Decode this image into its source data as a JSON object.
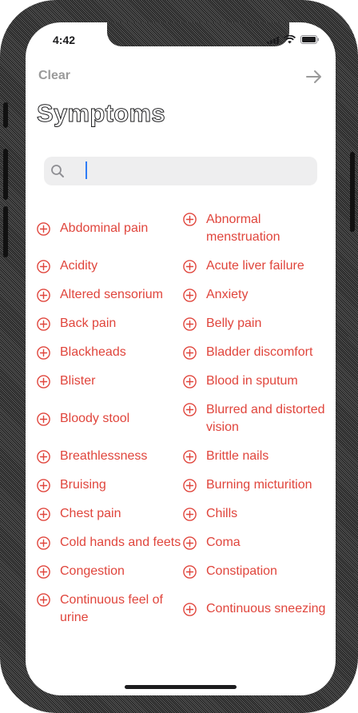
{
  "status_bar": {
    "time": "4:42"
  },
  "nav": {
    "clear_label": "Clear",
    "next_icon": "arrow-right-icon"
  },
  "title": "Symptoms",
  "search": {
    "value": "",
    "placeholder": ""
  },
  "colors": {
    "accent": "#e0453c",
    "muted": "#9a9a9a",
    "search_bg": "#eeeeef",
    "caret": "#2f7cf6"
  },
  "symptoms": [
    "Abdominal pain",
    "Abnormal menstruation",
    "Acidity",
    "Acute liver failure",
    "Altered sensorium",
    "Anxiety",
    "Back pain",
    "Belly pain",
    "Blackheads",
    "Bladder discomfort",
    "Blister",
    "Blood in sputum",
    "Bloody stool",
    "Blurred and distorted vision",
    "Breathlessness",
    "Brittle nails",
    "Bruising",
    "Burning micturition",
    "Chest pain",
    "Chills",
    "Cold hands and feets",
    "Coma",
    "Congestion",
    "Constipation",
    "Continuous feel of urine",
    "Continuous sneezing"
  ]
}
